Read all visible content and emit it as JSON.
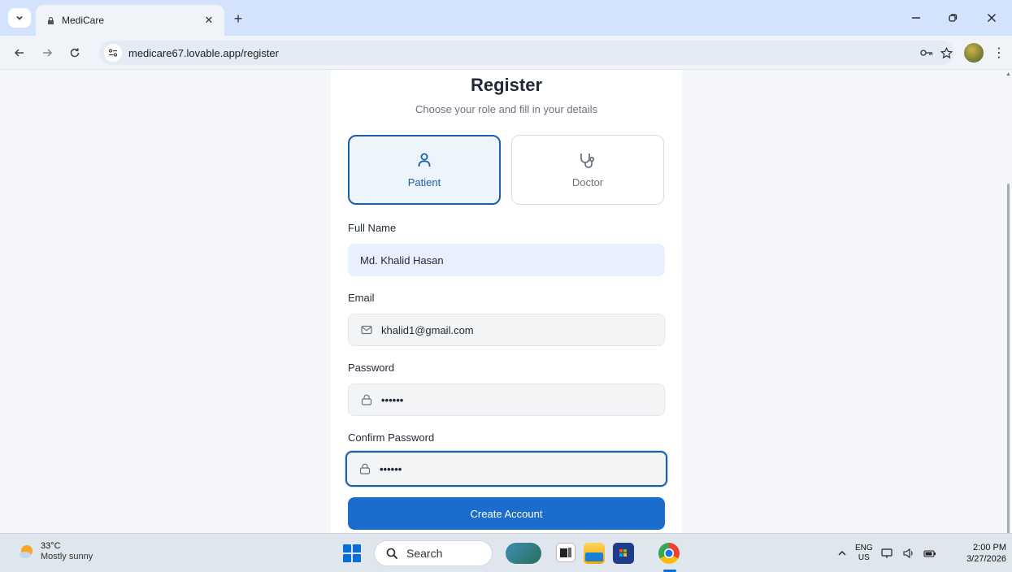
{
  "browser": {
    "tab_title": "MediCare",
    "url": "medicare67.lovable.app/register"
  },
  "form": {
    "title": "Register",
    "subtitle": "Choose your role and fill in your details",
    "roles": [
      {
        "label": "Patient",
        "selected": true,
        "icon": "user-icon"
      },
      {
        "label": "Doctor",
        "selected": false,
        "icon": "stethoscope-icon"
      }
    ],
    "full_name": {
      "label": "Full Name",
      "value": "Md. Khalid Hasan"
    },
    "email": {
      "label": "Email",
      "value": "khalid1@gmail.com",
      "icon": "mail-icon"
    },
    "password": {
      "label": "Password",
      "value": "••••••",
      "icon": "lock-icon"
    },
    "confirm_password": {
      "label": "Confirm Password",
      "value": "••••••",
      "icon": "lock-icon"
    },
    "submit_label": "Create Account"
  },
  "taskbar": {
    "weather_temp": "33°C",
    "weather_desc": "Mostly sunny",
    "search_label": "Search",
    "lang_line1": "ENG",
    "lang_line2": "US",
    "time": "2:00 PM",
    "date": "3/27/2026"
  },
  "colors": {
    "accent": "#1a6dcc",
    "selected_border": "#1a5fa8",
    "autofill_bg": "#e8f0fe"
  }
}
